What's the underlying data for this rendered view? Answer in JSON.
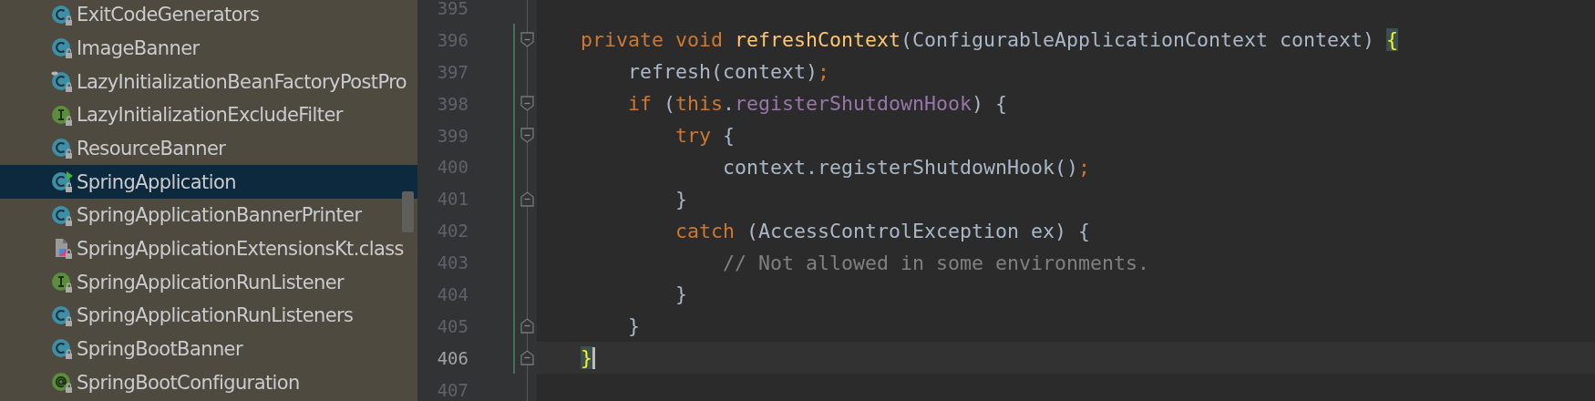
{
  "project_tree": {
    "items": [
      {
        "label": "ExitCodeGenerators",
        "kind": "class",
        "runnable": false,
        "selected": false
      },
      {
        "label": "ImageBanner",
        "kind": "class",
        "runnable": false,
        "selected": false
      },
      {
        "label": "LazyInitializationBeanFactoryPostPro",
        "kind": "class-marked",
        "runnable": false,
        "selected": false
      },
      {
        "label": "LazyInitializationExcludeFilter",
        "kind": "interface",
        "runnable": false,
        "selected": false
      },
      {
        "label": "ResourceBanner",
        "kind": "class",
        "runnable": false,
        "selected": false
      },
      {
        "label": "SpringApplication",
        "kind": "class",
        "runnable": true,
        "selected": true
      },
      {
        "label": "SpringApplicationBannerPrinter",
        "kind": "class",
        "runnable": false,
        "selected": false
      },
      {
        "label": "SpringApplicationExtensionsKt.class",
        "kind": "kotlin-file",
        "runnable": false,
        "selected": false
      },
      {
        "label": "SpringApplicationRunListener",
        "kind": "interface",
        "runnable": false,
        "selected": false
      },
      {
        "label": "SpringApplicationRunListeners",
        "kind": "class",
        "runnable": false,
        "selected": false
      },
      {
        "label": "SpringBootBanner",
        "kind": "class",
        "runnable": false,
        "selected": false
      },
      {
        "label": "SpringBootConfiguration",
        "kind": "annotation",
        "runnable": false,
        "selected": false
      }
    ]
  },
  "editor": {
    "lines": [
      {
        "number": "395",
        "current": false,
        "kind": "plain"
      },
      {
        "number": "396",
        "current": false,
        "kind": "fold-start",
        "tokens": [
          {
            "text": "private void ",
            "kind": "keyword"
          },
          {
            "text": "refreshContext",
            "kind": "method"
          },
          {
            "text": "(ConfigurableApplicationContext context) ",
            "kind": "plain"
          },
          {
            "text": "{",
            "kind": "brace-match"
          }
        ]
      },
      {
        "number": "397",
        "current": false,
        "kind": "plain",
        "tokens": [
          {
            "text": "    refresh(context)",
            "kind": "plain"
          },
          {
            "text": ";",
            "kind": "keyword"
          }
        ]
      },
      {
        "number": "398",
        "current": false,
        "kind": "fold-start",
        "tokens": [
          {
            "text": "    if",
            "kind": "keyword"
          },
          {
            "text": " (",
            "kind": "plain"
          },
          {
            "text": "this",
            "kind": "keyword"
          },
          {
            "text": ".",
            "kind": "plain"
          },
          {
            "text": "registerShutdownHook",
            "kind": "field"
          },
          {
            "text": ") {",
            "kind": "plain"
          }
        ]
      },
      {
        "number": "399",
        "current": false,
        "kind": "fold-start",
        "tokens": [
          {
            "text": "        try",
            "kind": "keyword"
          },
          {
            "text": " {",
            "kind": "plain"
          }
        ]
      },
      {
        "number": "400",
        "current": false,
        "kind": "plain",
        "tokens": [
          {
            "text": "            context.registerShutdownHook()",
            "kind": "plain"
          },
          {
            "text": ";",
            "kind": "keyword"
          }
        ]
      },
      {
        "number": "401",
        "current": false,
        "kind": "fold-end",
        "tokens": [
          {
            "text": "        }",
            "kind": "plain"
          }
        ]
      },
      {
        "number": "402",
        "current": false,
        "kind": "plain",
        "tokens": [
          {
            "text": "        catch",
            "kind": "keyword"
          },
          {
            "text": " (AccessControlException ex) {",
            "kind": "plain"
          }
        ]
      },
      {
        "number": "403",
        "current": false,
        "kind": "plain",
        "tokens": [
          {
            "text": "            // Not allowed in some environments.",
            "kind": "comment"
          }
        ]
      },
      {
        "number": "404",
        "current": false,
        "kind": "plain",
        "tokens": [
          {
            "text": "        }",
            "kind": "plain"
          }
        ]
      },
      {
        "number": "405",
        "current": false,
        "kind": "fold-end",
        "tokens": [
          {
            "text": "    }",
            "kind": "plain"
          }
        ]
      },
      {
        "number": "406",
        "current": true,
        "kind": "fold-end",
        "tokens": [
          {
            "text": "}",
            "kind": "brace-match"
          }
        ]
      },
      {
        "number": "407",
        "current": false,
        "kind": "plain"
      }
    ]
  }
}
